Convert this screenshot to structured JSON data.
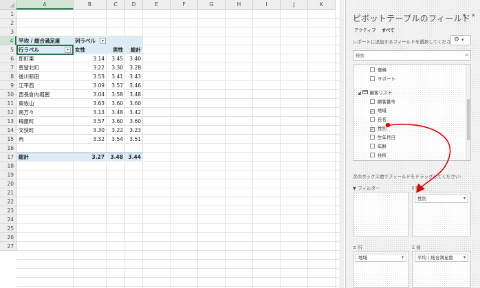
{
  "sheet": {
    "columns": [
      "A",
      "B",
      "C",
      "D",
      "E",
      "F",
      "G",
      "H",
      "I",
      "J",
      "K"
    ],
    "rows": [
      "1",
      "2",
      "3",
      "4",
      "5",
      "6",
      "7",
      "8",
      "9",
      "10",
      "11",
      "12",
      "13",
      "14",
      "15",
      "16",
      "17",
      "18",
      "19",
      "20",
      "21",
      "22",
      "23",
      "24",
      "25",
      "26",
      "27"
    ],
    "active_column": "A",
    "active_row": "4"
  },
  "pivot": {
    "title": "平均 / 総合満足度",
    "col_labels_caption": "列ラベル",
    "row_labels_caption": "行ラベル",
    "col_headers": [
      "女性",
      "男性",
      "総計"
    ],
    "rows": [
      {
        "label": "即町東",
        "values": [
          "3.14",
          "3.45",
          "3.40"
        ]
      },
      {
        "label": "恵留北町",
        "values": [
          "3.22",
          "3.30",
          "3.28"
        ]
      },
      {
        "label": "後川新田",
        "values": [
          "3.53",
          "3.41",
          "3.43"
        ]
      },
      {
        "label": "江平西",
        "values": [
          "3.09",
          "3.57",
          "3.46"
        ]
      },
      {
        "label": "西長倉内堀囲",
        "values": [
          "3.04",
          "3.58",
          "3.48"
        ]
      },
      {
        "label": "東恢山",
        "values": [
          "3.63",
          "3.60",
          "3.60"
        ]
      },
      {
        "label": "南万々",
        "values": [
          "3.13",
          "3.48",
          "3.42"
        ]
      },
      {
        "label": "梅屋町",
        "values": [
          "3.57",
          "3.60",
          "3.60"
        ]
      },
      {
        "label": "文快町",
        "values": [
          "3.30",
          "3.22",
          "3.23"
        ]
      },
      {
        "label": "丙",
        "values": [
          "3.32",
          "3.54",
          "3.51"
        ]
      }
    ],
    "total_label": "総計",
    "total_values": [
      "3.27",
      "3.48",
      "3.44"
    ]
  },
  "pane": {
    "title": "ピボットテーブルのフィールド",
    "dropdown_glyph": "▾",
    "close_glyph": "✕",
    "tabs": [
      "アクティブ",
      "すべて"
    ],
    "active_tab": "すべて",
    "hint": "レポートに追加するフィールドを選択してください:",
    "gear_glyph": "⚙",
    "search_placeholder": "検索",
    "search_glyph": "⌕",
    "fields_top": [
      {
        "label": "価格",
        "checked": false
      },
      {
        "label": "サポート",
        "checked": false
      }
    ],
    "table_name": "顧客リスト",
    "fields_table": [
      {
        "label": "顧客番号",
        "checked": false
      },
      {
        "label": "地域",
        "checked": true
      },
      {
        "label": "氏名",
        "checked": false
      },
      {
        "label": "性別",
        "checked": true
      },
      {
        "label": "生年月日",
        "checked": false
      },
      {
        "label": "年齢",
        "checked": false
      },
      {
        "label": "住所",
        "checked": false
      }
    ],
    "areas_hint": "次のボックス間でフィールドをドラッグしてください:",
    "areas": {
      "filter": {
        "label": "フィルター",
        "items": []
      },
      "columns": {
        "label": "列",
        "items": [
          "性別"
        ]
      },
      "rows": {
        "label": "行",
        "items": [
          "地域"
        ]
      },
      "values": {
        "label": "値",
        "items": [
          "平均 / 総合満足度"
        ]
      }
    }
  },
  "colors": {
    "accent": "#217346",
    "pivot_header": "#ddebf7",
    "annotation": "#e00000"
  }
}
